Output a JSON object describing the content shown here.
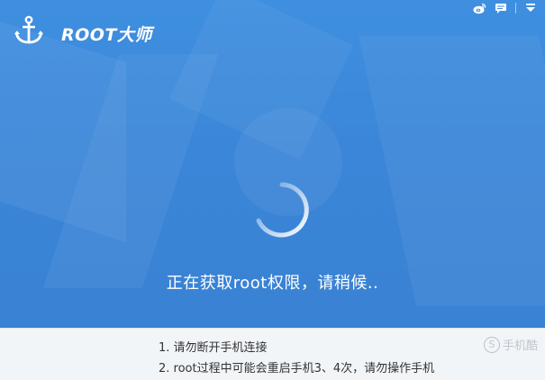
{
  "app": {
    "title": "ROOT大师",
    "icon": "anchor-icon"
  },
  "window_controls": [
    {
      "name": "weibo-icon"
    },
    {
      "name": "feedback-icon"
    },
    {
      "name": "menu-dropdown-icon"
    }
  ],
  "progress": {
    "status_text": "正在获取root权限，请稍候.."
  },
  "tips": [
    "1. 请勿断开手机连接",
    "2. root过程中可能会重启手机3、4次，请勿操作手机"
  ],
  "watermark": {
    "badge": "S",
    "text": "手机酷"
  },
  "colors": {
    "hero_blue": "#3b86d8",
    "footer_bg": "#f2f5f8",
    "text_dark": "#333333",
    "white": "#ffffff"
  }
}
